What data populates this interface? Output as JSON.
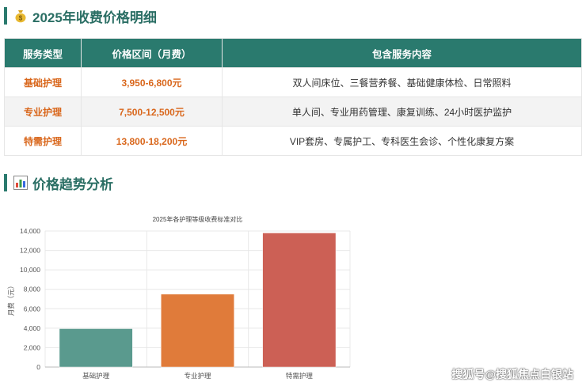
{
  "heading_price": "2025年收费价格明细",
  "heading_trend": "价格趋势分析",
  "table": {
    "headers": [
      "服务类型",
      "价格区间（月费）",
      "包含服务内容"
    ],
    "rows": [
      {
        "type": "基础护理",
        "price": "3,950-6,800元",
        "services": "双人间床位、三餐营养餐、基础健康体检、日常照料"
      },
      {
        "type": "专业护理",
        "price": "7,500-12,500元",
        "services": "单人间、专业用药管理、康复训练、24小时医护监护"
      },
      {
        "type": "特需护理",
        "price": "13,800-18,200元",
        "services": "VIP套房、专属护工、专科医生会诊、个性化康复方案"
      }
    ]
  },
  "chart_data": {
    "type": "bar",
    "title": "2025年各护理等级收费标准对比",
    "categories": [
      "基础护理",
      "专业护理",
      "特需护理"
    ],
    "values": [
      3950,
      7500,
      13800
    ],
    "colors": [
      "#5a9a8e",
      "#e07b3a",
      "#cc6055"
    ],
    "ylabel": "月费（元）",
    "ylim": [
      0,
      14000
    ],
    "yticks": [
      "0",
      "2,000",
      "4,000",
      "6,000",
      "8,000",
      "10,000",
      "12,000",
      "14,000"
    ],
    "grid": true
  },
  "watermark": "搜狐号@搜狐焦点白银站",
  "colors": {
    "accent": "#2a7a6e",
    "price": "#d9671c"
  }
}
